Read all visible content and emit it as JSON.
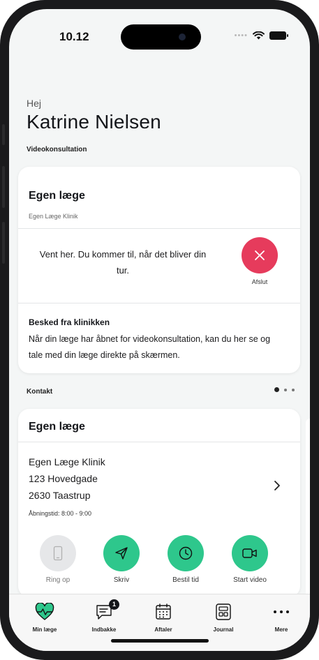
{
  "status_bar": {
    "time": "10.12"
  },
  "header": {
    "greeting": "Hej",
    "user_name": "Katrine Nielsen"
  },
  "video_section": {
    "label": "Videokonsultation",
    "card": {
      "title": "Egen læge",
      "subtitle": "Egen Læge Klinik",
      "wait_message": "Vent her. Du kommer til, når det bliver din tur.",
      "end_label": "Afslut",
      "message_title": "Besked fra klinikken",
      "message_body": "Når din læge har åbnet for videokonsultation, kan du her se og tale med din læge direkte på skærmen."
    }
  },
  "contact_section": {
    "label": "Kontakt",
    "pager": {
      "pages": 3,
      "active": 1
    },
    "card": {
      "title": "Egen læge",
      "clinic_name": "Egen Læge Klinik",
      "street": "123 Hovedgade",
      "city": "2630 Taastrup",
      "opening_hours": "Åbningstid: 8:00 - 9:00",
      "actions": [
        {
          "label": "Ring op",
          "icon": "phone-icon",
          "enabled": false
        },
        {
          "label": "Skriv",
          "icon": "send-icon",
          "enabled": true
        },
        {
          "label": "Bestil tid",
          "icon": "clock-icon",
          "enabled": true
        },
        {
          "label": "Start video",
          "icon": "video-icon",
          "enabled": true
        }
      ]
    }
  },
  "tab_bar": {
    "tabs": [
      {
        "label": "Min læge",
        "icon": "heart-pulse-icon",
        "active": true
      },
      {
        "label": "Indbakke",
        "icon": "chat-icon",
        "badge": "1"
      },
      {
        "label": "Aftaler",
        "icon": "calendar-icon"
      },
      {
        "label": "Journal",
        "icon": "journal-icon"
      },
      {
        "label": "Mere",
        "icon": "more-icon"
      }
    ]
  },
  "colors": {
    "accent_green": "#2ec78c",
    "end_red": "#e63b5c",
    "background": "#f4f6f6",
    "disabled_gray": "#e6e7e9"
  }
}
